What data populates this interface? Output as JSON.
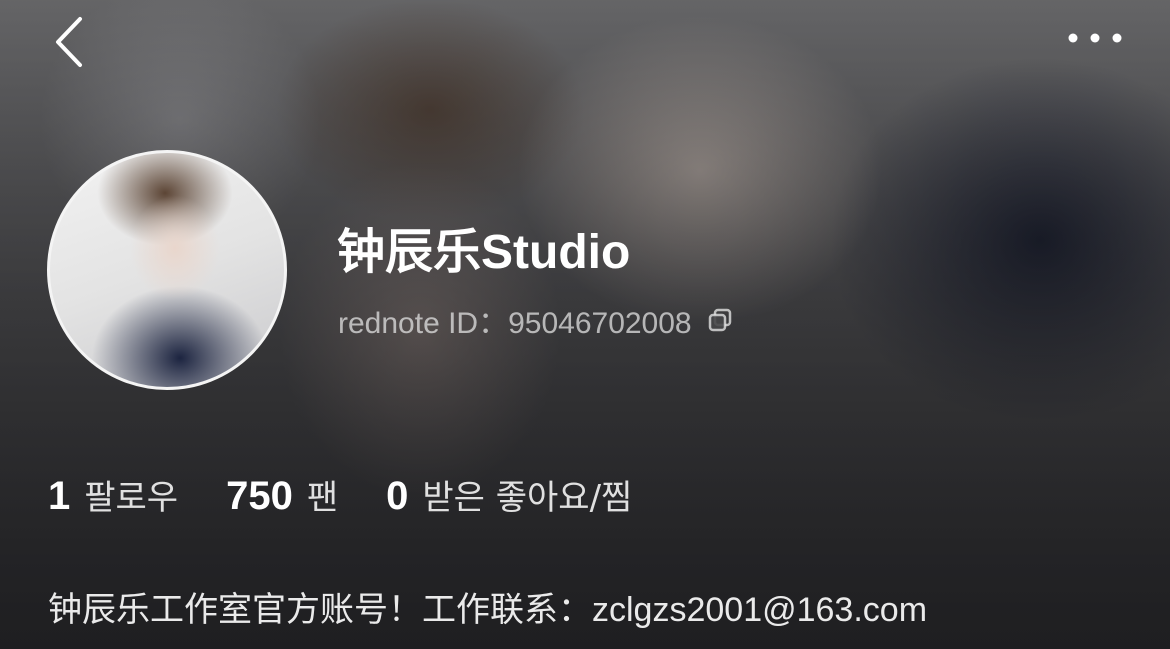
{
  "header": {
    "back_icon": "chevron-left-icon",
    "more_icon": "ellipsis-icon"
  },
  "profile": {
    "name": "钟辰乐Studio",
    "id_text": "rednote ID：95046702008",
    "copy_icon": "copy-icon"
  },
  "stats": [
    {
      "value": "1",
      "label": "팔로우"
    },
    {
      "value": "750",
      "label": "팬"
    },
    {
      "value": "0",
      "label": "받은 좋아요/찜"
    }
  ],
  "bio": "钟辰乐工作室官方账号！工作联系：zclgzs2001@163.com"
}
